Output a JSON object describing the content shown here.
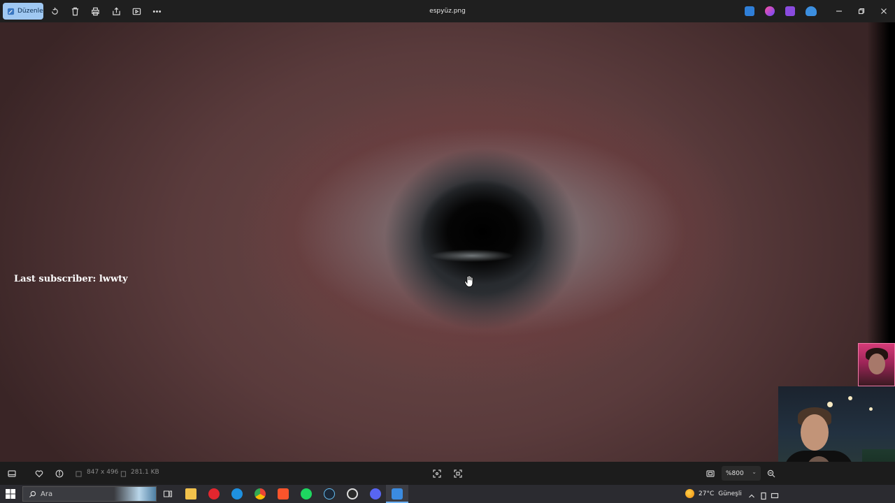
{
  "toolbar": {
    "edit_label": "Düzenle",
    "file_title": "espyüz.png"
  },
  "canvas": {
    "overlay_text": "Last subscriber: lwwty"
  },
  "statusbar": {
    "dimensions": "847 x 496",
    "file_size": "281.1 KB",
    "zoom": "%800"
  },
  "taskbar": {
    "search_placeholder": "Ara",
    "temperature": "27°C",
    "weather_text": "Güneşli"
  },
  "colors": {
    "edit_button": "#9fc8f2",
    "titlebar": "#1f1f1f",
    "statusbar": "#1c1c1c",
    "taskbar": "#2b2b30",
    "active_indicator": "#6fb4ff"
  }
}
